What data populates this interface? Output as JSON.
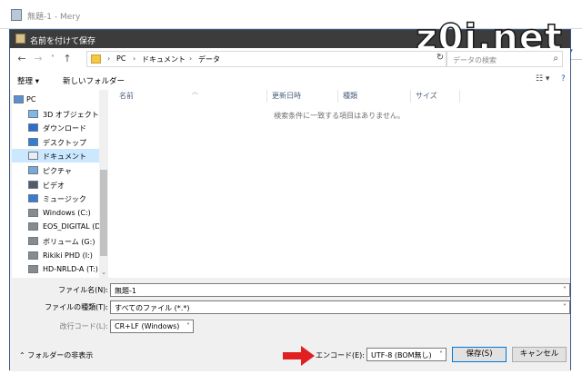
{
  "outer_window": {
    "title": "無題-1 - Mery"
  },
  "dialog": {
    "title": "名前を付けて保存",
    "watermark": "z0i.net",
    "side_button": "▾"
  },
  "nav": {
    "back": "←",
    "forward": "→",
    "recent": "˅",
    "up": "↑",
    "breadcrumbs": [
      "PC",
      "ドキュメント",
      "データ"
    ],
    "search_placeholder": "データの検索"
  },
  "toolbar": {
    "organize": "整理 ▾",
    "new_folder": "新しいフォルダー",
    "view": "☷ ▾",
    "help": "?"
  },
  "navpane": {
    "items": [
      {
        "label": "PC",
        "icon": "pc-icon",
        "root": true
      },
      {
        "label": "3D オブジェクト",
        "icon": "3d-objects-icon"
      },
      {
        "label": "ダウンロード",
        "icon": "download-icon"
      },
      {
        "label": "デスクトップ",
        "icon": "desktop-icon"
      },
      {
        "label": "ドキュメント",
        "icon": "documents-icon",
        "selected": true
      },
      {
        "label": "ピクチャ",
        "icon": "pictures-icon"
      },
      {
        "label": "ビデオ",
        "icon": "videos-icon"
      },
      {
        "label": "ミュージック",
        "icon": "music-icon"
      },
      {
        "label": "Windows (C:)",
        "icon": "drive-icon"
      },
      {
        "label": "EOS_DIGITAL (D:",
        "icon": "drive-icon"
      },
      {
        "label": "ボリューム (G:)",
        "icon": "drive-icon"
      },
      {
        "label": "Rikiki PHD (I:)",
        "icon": "drive-icon"
      },
      {
        "label": "HD-NRLD-A (T:)",
        "icon": "drive-icon"
      }
    ]
  },
  "filelist": {
    "columns": [
      "名前",
      "更新日時",
      "種類",
      "サイズ"
    ],
    "empty_message": "検索条件に一致する項目はありません。"
  },
  "form": {
    "filename_label": "ファイル名(N):",
    "filename_value": "無題-1",
    "filetype_label": "ファイルの種類(T):",
    "filetype_value": "すべてのファイル (*.*)",
    "newline_label": "改行コード(L):",
    "newline_value": "CR+LF (Windows)",
    "encoding_label": "エンコード(E):",
    "encoding_value": "UTF-8 (BOM無し)",
    "save_button": "保存(S)",
    "cancel_button": "キャンセル",
    "hide_folders": "フォルダーの非表示"
  },
  "colors": {
    "dialog_title_bg": "#3c3c3c",
    "selection": "#cce8ff",
    "accent_blue": "#0078d7",
    "arrow_red": "#e02020"
  }
}
